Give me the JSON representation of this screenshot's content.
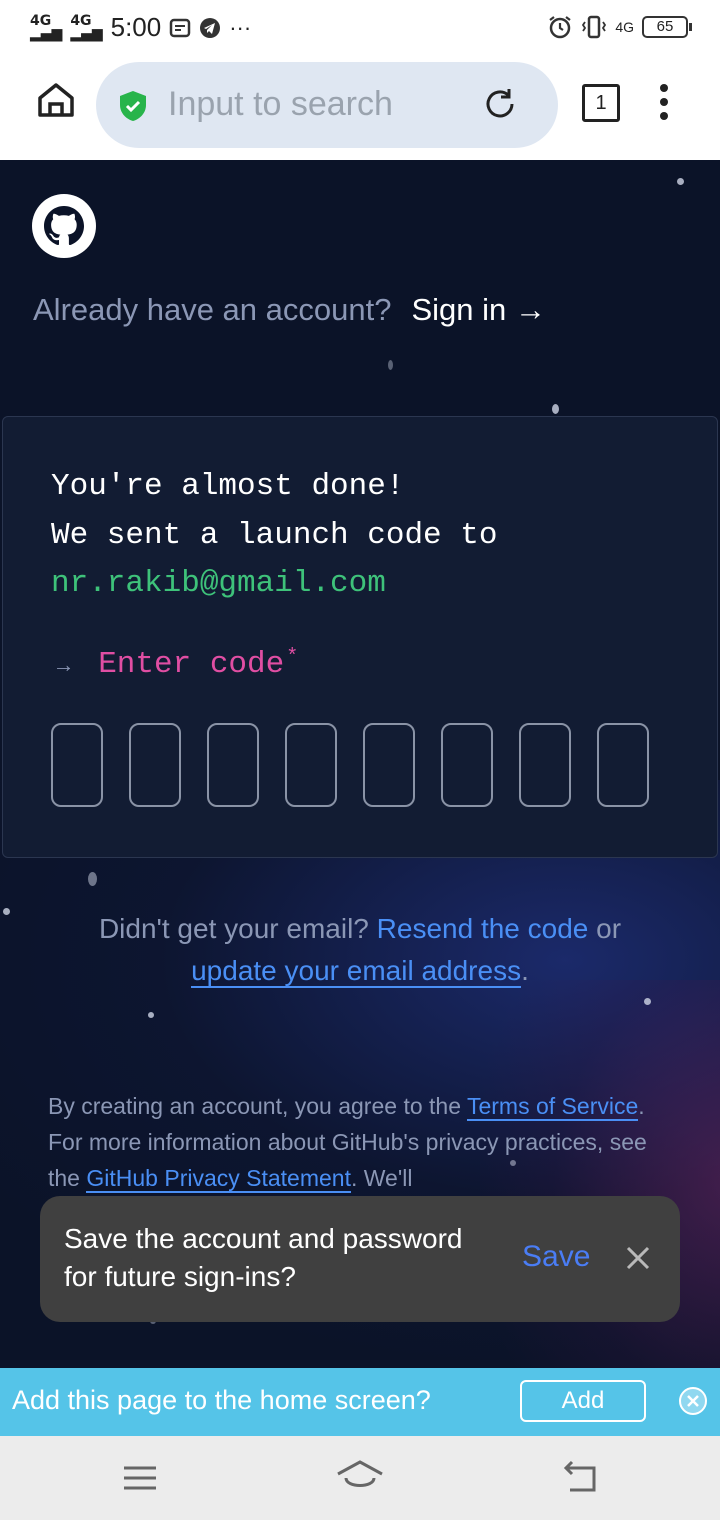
{
  "status_bar": {
    "signal1": "4G",
    "signal2": "4G",
    "time": "5:00",
    "more": "···",
    "net": "4G",
    "battery": "65"
  },
  "browser": {
    "url_placeholder": "Input to search",
    "tab_count": "1"
  },
  "page": {
    "signin_prompt": "Already have an account?",
    "signin_link": "Sign in →",
    "card": {
      "line1": "You're almost done!",
      "line2": "We sent a launch code to",
      "email": "nr.rakib@gmail.com",
      "enter_arrow": "→",
      "enter_label": "Enter code",
      "required_mark": "*",
      "code_boxes": 8
    },
    "resend": {
      "prefix": "Didn't get your email?",
      "resend_link": "Resend the code",
      "or": "or",
      "update_link": "update your email address",
      "period": "."
    },
    "terms": {
      "part1": "By creating an account, you agree to the",
      "terms_link": "Terms of Service",
      "part2": ". For more information about GitHub's privacy practices, see the",
      "privacy_link": "GitHub Privacy Statement",
      "part3": ". We'll"
    }
  },
  "save_toast": {
    "message": "Save the account and password for future sign-ins?",
    "save_label": "Save"
  },
  "add_home_bar": {
    "message": "Add this page to the home screen?",
    "add_label": "Add"
  },
  "colors": {
    "page_bg": "#0b1328",
    "email_green": "#3ec27a",
    "enter_pink": "#e04ea3",
    "link_blue": "#4a8ff5",
    "add_bar": "#55c4e8"
  }
}
